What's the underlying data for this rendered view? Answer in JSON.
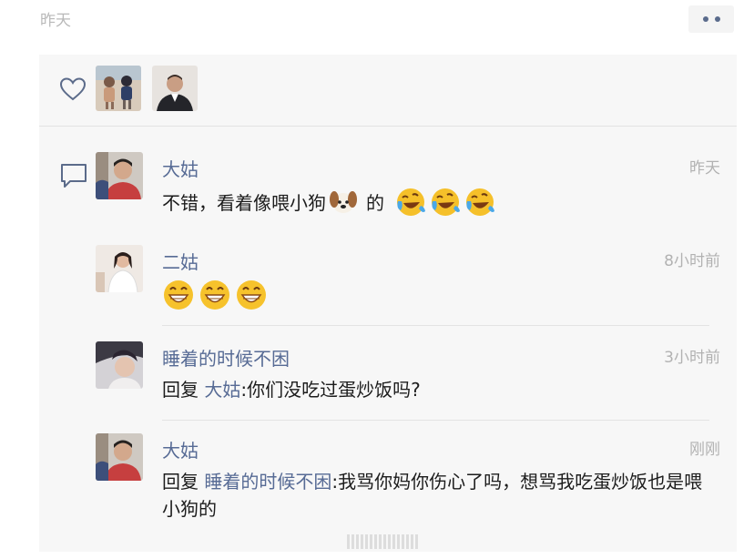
{
  "post": {
    "time": "昨天",
    "more_icon": "more-dots-icon"
  },
  "likes": {
    "icon": "heart-icon",
    "avatars": [
      "avatar-liker-1",
      "avatar-liker-2"
    ]
  },
  "comments_icon": "comment-icon",
  "comments": [
    {
      "name": "大姑",
      "time": "昨天",
      "text_before": "不错，看着像喂小狗",
      "text_after": "的",
      "inline_emoji": "dog-emoji",
      "trailing_emojis": [
        "laugh-cry-emoji",
        "laugh-cry-emoji",
        "laugh-cry-emoji"
      ]
    },
    {
      "name": "二姑",
      "time": "8小时前",
      "emojis": [
        "grin-emoji",
        "grin-emoji",
        "grin-emoji"
      ]
    },
    {
      "name": "睡着的时候不困",
      "time": "3小时前",
      "reply_word": "回复",
      "reply_to": "大姑",
      "text": ":你们没吃过蛋炒饭吗?"
    },
    {
      "name": "大姑",
      "time": "刚刚",
      "reply_word": "回复",
      "reply_to": "睡着的时候不困",
      "text": ":我骂你妈你伤心了吗，想骂我吃蛋炒饭也是喂小狗的"
    }
  ],
  "colors": {
    "name": "#576b95",
    "text": "#1c1c1c",
    "time": "#b2b2b2",
    "panel": "#f7f7f7"
  }
}
